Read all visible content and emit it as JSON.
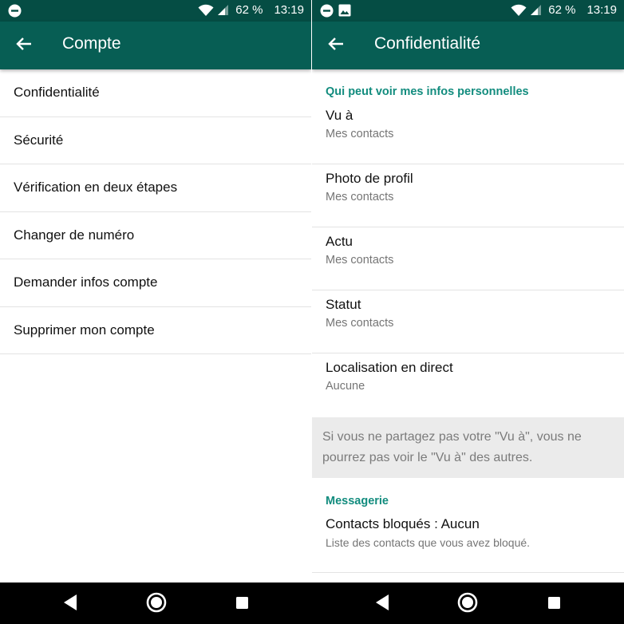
{
  "status_bar": {
    "battery": "62 %",
    "time": "13:19"
  },
  "left_screen": {
    "title": "Compte",
    "items": [
      {
        "label": "Confidentialité"
      },
      {
        "label": "Sécurité"
      },
      {
        "label": "Vérification en deux étapes"
      },
      {
        "label": "Changer de numéro"
      },
      {
        "label": "Demander infos compte"
      },
      {
        "label": "Supprimer mon compte"
      }
    ]
  },
  "right_screen": {
    "title": "Confidentialité",
    "section_personal": "Qui peut voir mes infos personnelles",
    "settings": [
      {
        "title": "Vu à",
        "value": "Mes contacts"
      },
      {
        "title": "Photo de profil",
        "value": "Mes contacts"
      },
      {
        "title": "Actu",
        "value": "Mes contacts"
      },
      {
        "title": "Statut",
        "value": "Mes contacts"
      },
      {
        "title": "Localisation en direct",
        "value": "Aucune"
      }
    ],
    "notice": "Si vous ne partagez pas votre \"Vu à\", vous ne pourrez pas voir le \"Vu à\" des autres.",
    "section_messaging": "Messagerie",
    "blocked": {
      "title": "Contacts bloqués : Aucun",
      "subtitle": "Liste des contacts que vous avez bloqué."
    }
  },
  "colors": {
    "status_bar": "#054d44",
    "app_bar": "#075e54",
    "accent": "#128c7e",
    "nav_bar": "#000000"
  },
  "icons": {
    "status_left": [
      "do-not-disturb-icon",
      "image-icon"
    ],
    "status_right": [
      "wifi-icon",
      "cell-signal-icon"
    ],
    "app_bar": "back-arrow-icon",
    "nav": [
      "back-triangle-icon",
      "home-circle-icon",
      "recents-square-icon"
    ]
  }
}
